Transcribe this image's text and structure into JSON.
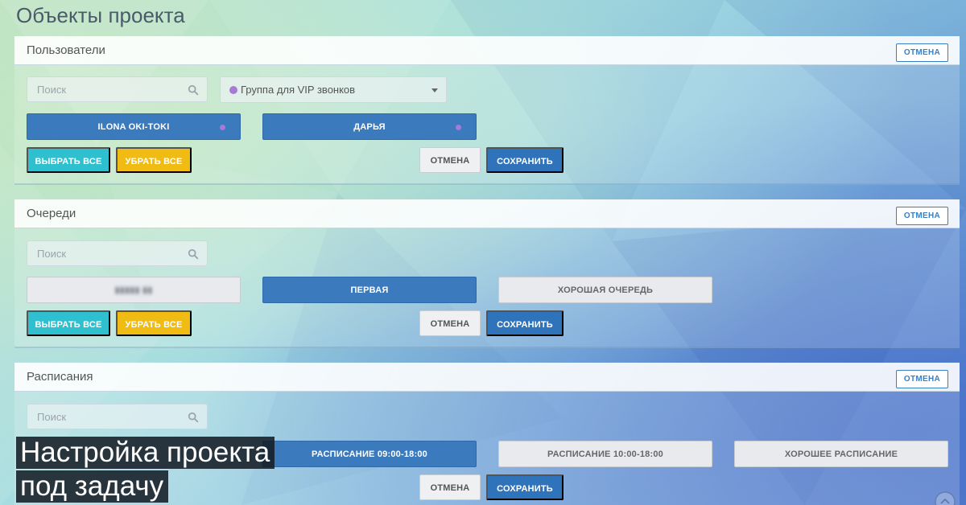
{
  "page": {
    "title": "Объекты проекта"
  },
  "colors": {
    "primary": "#3a7abd",
    "save": "#2f74bb",
    "select_all": "#2fc0cf",
    "remove_all": "#f0bb12",
    "group_dot": "#a77ad6"
  },
  "icons": {
    "search": "search-icon",
    "caret": "chevron-down-icon"
  },
  "users": {
    "title": "Пользователи",
    "header_cancel": "ОТМЕНА",
    "search_placeholder": "Поиск",
    "group_select": {
      "value": "Группа для VIP звонков"
    },
    "items": [
      {
        "label": "ILONA OKI-TOKI",
        "selected": true
      },
      {
        "label": "ДАРЬЯ",
        "selected": true
      }
    ],
    "select_all": "ВЫБРАТЬ ВСЕ",
    "remove_all": "УБРАТЬ ВСЕ",
    "cancel": "ОТМЕНА",
    "save": "СОХРАНИТЬ"
  },
  "queues": {
    "title": "Очереди",
    "header_cancel": "ОТМЕНА",
    "search_placeholder": "Поиск",
    "items": [
      {
        "label": "",
        "selected": false,
        "blurred": true
      },
      {
        "label": "ПЕРВАЯ",
        "selected": true
      },
      {
        "label": "ХОРОШАЯ ОЧЕРЕДЬ",
        "selected": false
      }
    ],
    "select_all": "ВЫБРАТЬ ВСЕ",
    "remove_all": "УБРАТЬ ВСЕ",
    "cancel": "ОТМЕНА",
    "save": "СОХРАНИТЬ"
  },
  "schedules": {
    "title": "Расписания",
    "header_cancel": "ОТМЕНА",
    "search_placeholder": "Поиск",
    "items": [
      {
        "label": "РАСПИСАНИЕ 09:00-18:00",
        "selected": true
      },
      {
        "label": "РАСПИСАНИЕ 10:00-18:00",
        "selected": false
      },
      {
        "label": "ХОРОШЕЕ РАСПИСАНИЕ",
        "selected": false
      }
    ],
    "cancel": "ОТМЕНА",
    "save": "СОХРАНИТЬ"
  },
  "caption": {
    "line1": "Настройка проекта",
    "line2": "под задачу"
  }
}
